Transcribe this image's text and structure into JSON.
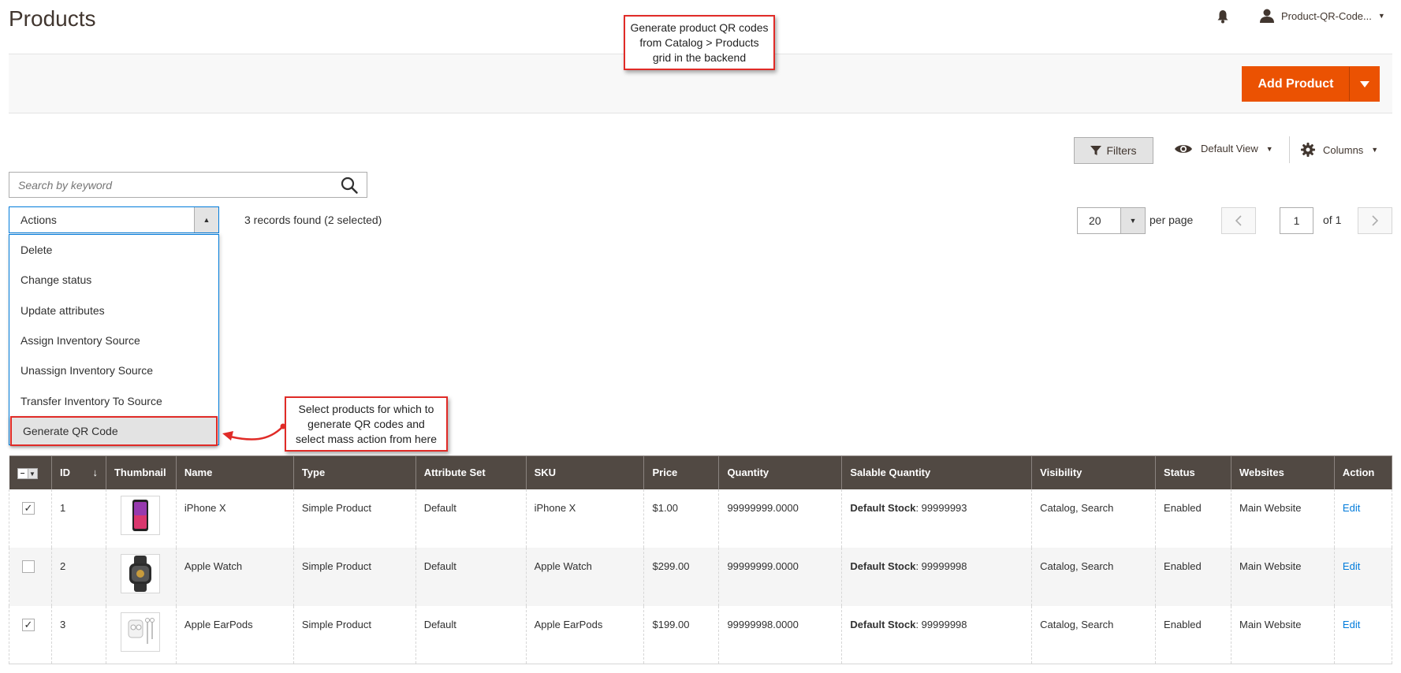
{
  "page": {
    "title": "Products"
  },
  "header": {
    "user": "Product-QR-Code..."
  },
  "callouts": {
    "top": [
      "Generate product QR codes",
      "from Catalog > Products",
      "grid in the backend"
    ],
    "mid": [
      "Select products for which to",
      "generate QR codes and",
      "select mass action from here"
    ]
  },
  "toolbar": {
    "add_product": "Add Product",
    "filters": "Filters",
    "default_view": "Default View",
    "columns": "Columns"
  },
  "search": {
    "placeholder": "Search by keyword"
  },
  "actions": {
    "label": "Actions",
    "items": [
      "Delete",
      "Change status",
      "Update attributes",
      "Assign Inventory Source",
      "Unassign Inventory Source",
      "Transfer Inventory To Source",
      "Generate QR Code"
    ]
  },
  "records": "3 records found (2 selected)",
  "pagination": {
    "per_page_value": "20",
    "per_page_label": "per page",
    "current_page": "1",
    "of_label": "of 1"
  },
  "grid": {
    "columns": [
      "ID",
      "Thumbnail",
      "Name",
      "Type",
      "Attribute Set",
      "SKU",
      "Price",
      "Quantity",
      "Salable Quantity",
      "Visibility",
      "Status",
      "Websites",
      "Action"
    ],
    "sort_indicator": "↓",
    "stock_label": "Default Stock",
    "rows": [
      {
        "checked": true,
        "id": "1",
        "name": "iPhone X",
        "type": "Simple Product",
        "attribute_set": "Default",
        "sku": "iPhone X",
        "price": "$1.00",
        "quantity": "99999999.0000",
        "salable": ": 99999993",
        "visibility": "Catalog, Search",
        "status": "Enabled",
        "websites": "Main Website",
        "action": "Edit"
      },
      {
        "checked": false,
        "id": "2",
        "name": "Apple Watch",
        "type": "Simple Product",
        "attribute_set": "Default",
        "sku": "Apple Watch",
        "price": "$299.00",
        "quantity": "99999999.0000",
        "salable": ": 99999998",
        "visibility": "Catalog, Search",
        "status": "Enabled",
        "websites": "Main Website",
        "action": "Edit"
      },
      {
        "checked": true,
        "id": "3",
        "name": "Apple EarPods",
        "type": "Simple Product",
        "attribute_set": "Default",
        "sku": "Apple EarPods",
        "price": "$199.00",
        "quantity": "99999998.0000",
        "salable": ": 99999998",
        "visibility": "Catalog, Search",
        "status": "Enabled",
        "websites": "Main Website",
        "action": "Edit"
      }
    ]
  },
  "colors": {
    "accent": "#eb5202",
    "grid_header": "#514943",
    "callout_border": "#e02b27",
    "link": "#007bdb"
  }
}
